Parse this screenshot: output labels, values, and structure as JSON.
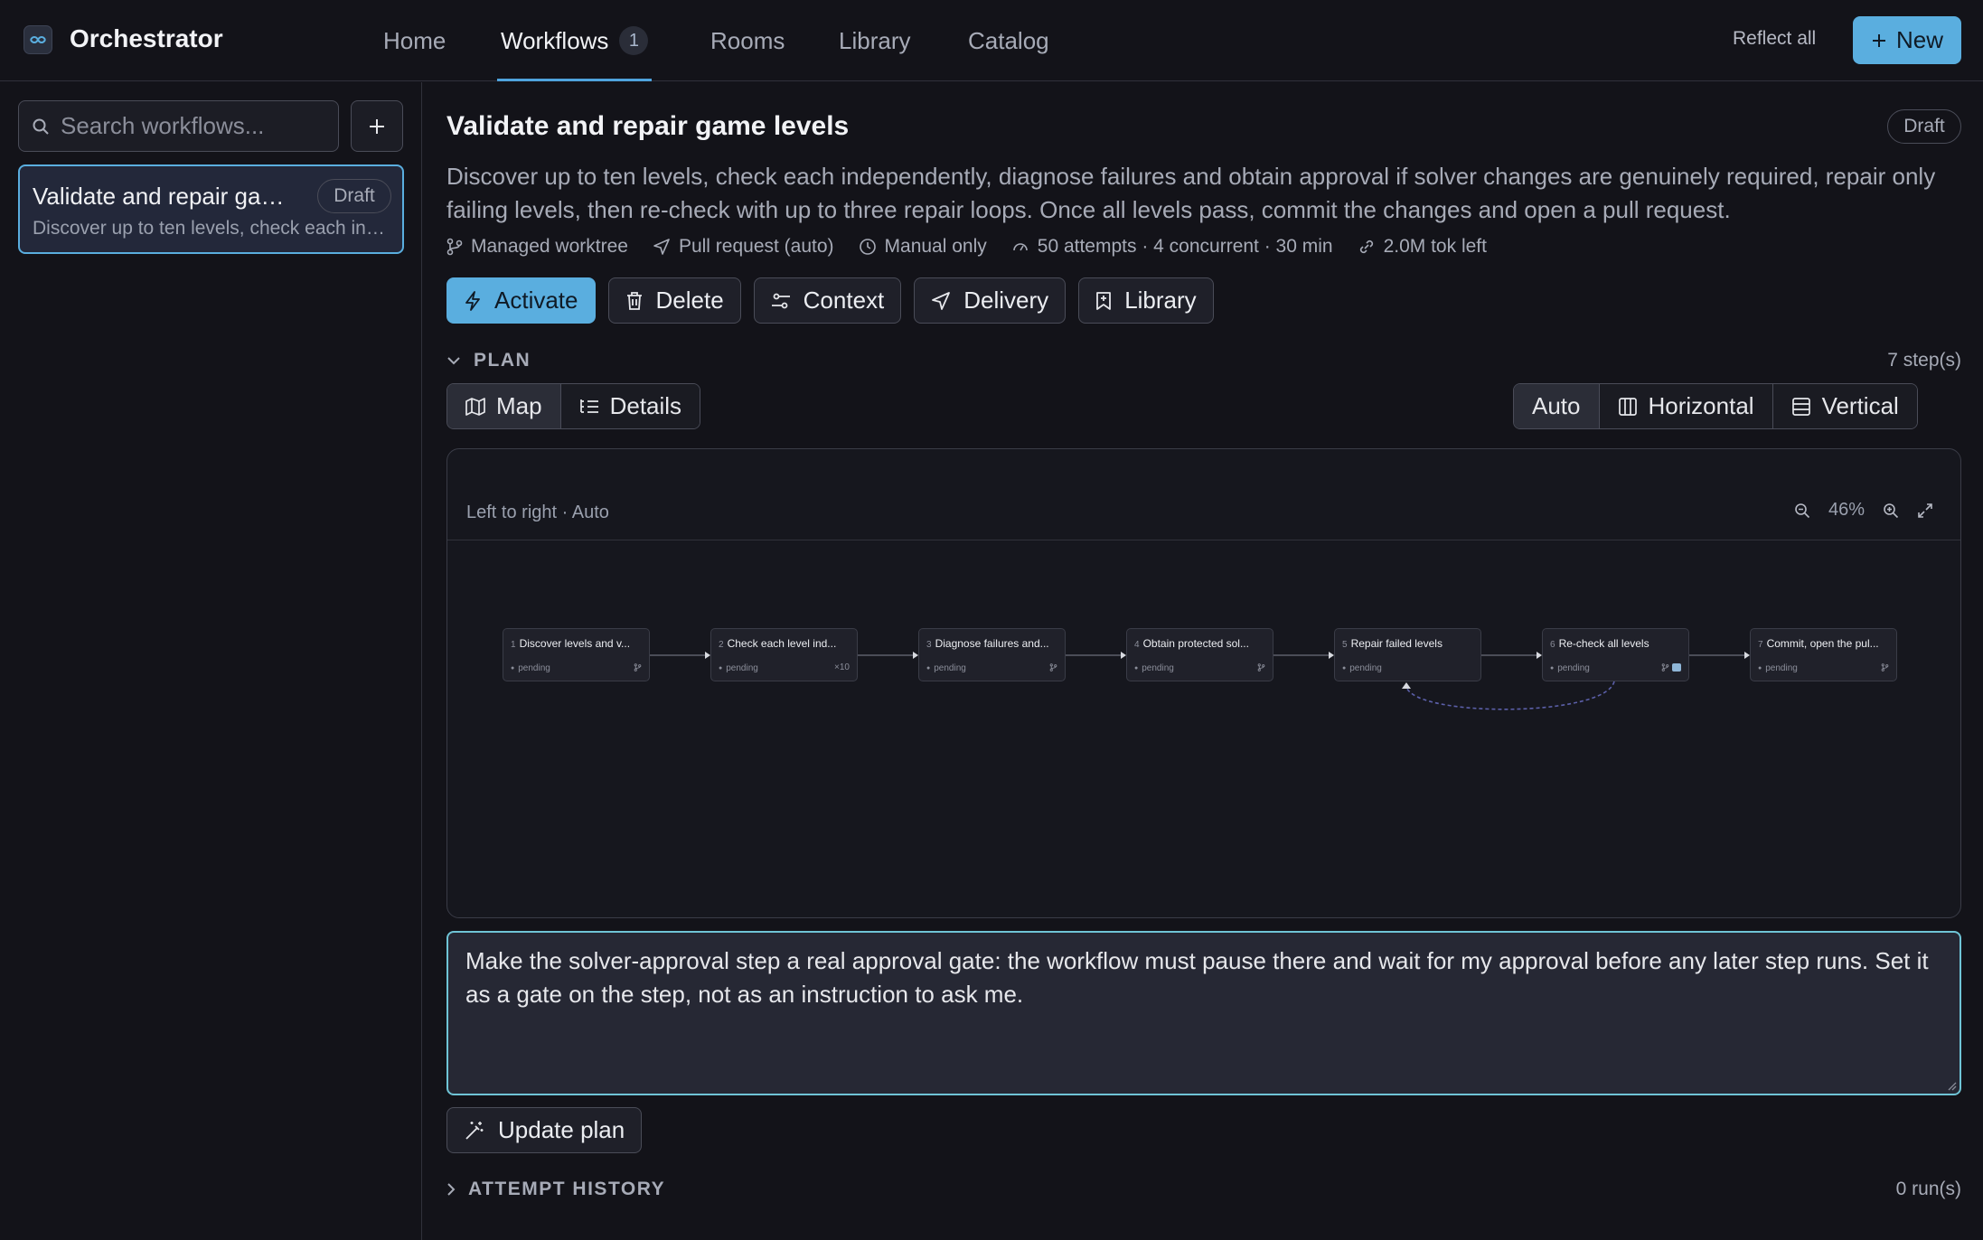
{
  "app": {
    "name": "Orchestrator"
  },
  "nav": [
    {
      "label": "Home"
    },
    {
      "label": "Workflows",
      "badge": "1",
      "active": true
    },
    {
      "label": "Rooms"
    },
    {
      "label": "Library"
    },
    {
      "label": "Catalog"
    }
  ],
  "header": {
    "reflect_label": "Reflect all",
    "new_label": "New"
  },
  "sidebar": {
    "search_placeholder": "Search workflows...",
    "workflows": [
      {
        "title": "Validate and repair game levels",
        "status": "Draft",
        "description": "Discover up to ten levels, check each independently, diagnose failures and obtain approval if solver changes are genuinely required, repair only failing levels, then re-check with up to three repair loops. Once all levels pass, commit the changes and open a pull request.",
        "selected": true
      }
    ]
  },
  "workflow": {
    "title": "Validate and repair game levels",
    "status": "Draft",
    "description": "Discover up to ten levels, check each independently, diagnose failures and obtain approval if solver changes are genuinely required, repair only failing levels, then re-check with up to three repair loops. Once all levels pass, commit the changes and open a pull request.",
    "meta": {
      "worktree": "Managed worktree",
      "delivery": "Pull request (auto)",
      "trigger": "Manual only",
      "limits": "50 attempts · 4 concurrent · 30 min",
      "tokens": "2.0M tok left"
    },
    "actions": {
      "activate": "Activate",
      "delete": "Delete",
      "context": "Context",
      "delivery": "Delivery",
      "library": "Library"
    }
  },
  "plan": {
    "heading": "PLAN",
    "step_count": "7 step(s)",
    "views": {
      "map": "Map",
      "details": "Details",
      "active": "map"
    },
    "layouts": {
      "auto": "Auto",
      "horizontal": "Horizontal",
      "vertical": "Vertical",
      "active": "auto"
    },
    "map": {
      "direction_label": "Left to right · Auto",
      "zoom": "46%",
      "steps": [
        {
          "num": "1",
          "title": "Discover levels and v...",
          "status": "pending",
          "marker": "branch-icon"
        },
        {
          "num": "2",
          "title": "Check each level ind...",
          "status": "pending",
          "marker": "×10"
        },
        {
          "num": "3",
          "title": "Diagnose failures and...",
          "status": "pending",
          "marker": "branch-icon"
        },
        {
          "num": "4",
          "title": "Obtain protected sol...",
          "status": "pending",
          "marker": "branch-icon"
        },
        {
          "num": "5",
          "title": "Repair failed levels",
          "status": "pending",
          "marker": ""
        },
        {
          "num": "6",
          "title": "Re-check all levels",
          "status": "pending",
          "marker": "branch-icon"
        },
        {
          "num": "7",
          "title": "Commit, open the pul...",
          "status": "pending",
          "marker": "branch-icon"
        }
      ],
      "loop": {
        "from_step": "6",
        "to_step": "5"
      }
    }
  },
  "prompt": {
    "value": "Make the solver-approval step a real approval gate: the workflow must pause there and wait for my approval before any later step runs. Set it as a gate on the step, not as an instruction to ask me."
  },
  "update_label": "Update plan",
  "history": {
    "heading": "ATTEMPT HISTORY",
    "runs": "0 run(s)"
  },
  "colors": {
    "accent": "#5aaedf",
    "background": "#131319",
    "focus": "#6fc4d6",
    "loop": "#5b5fa8"
  }
}
